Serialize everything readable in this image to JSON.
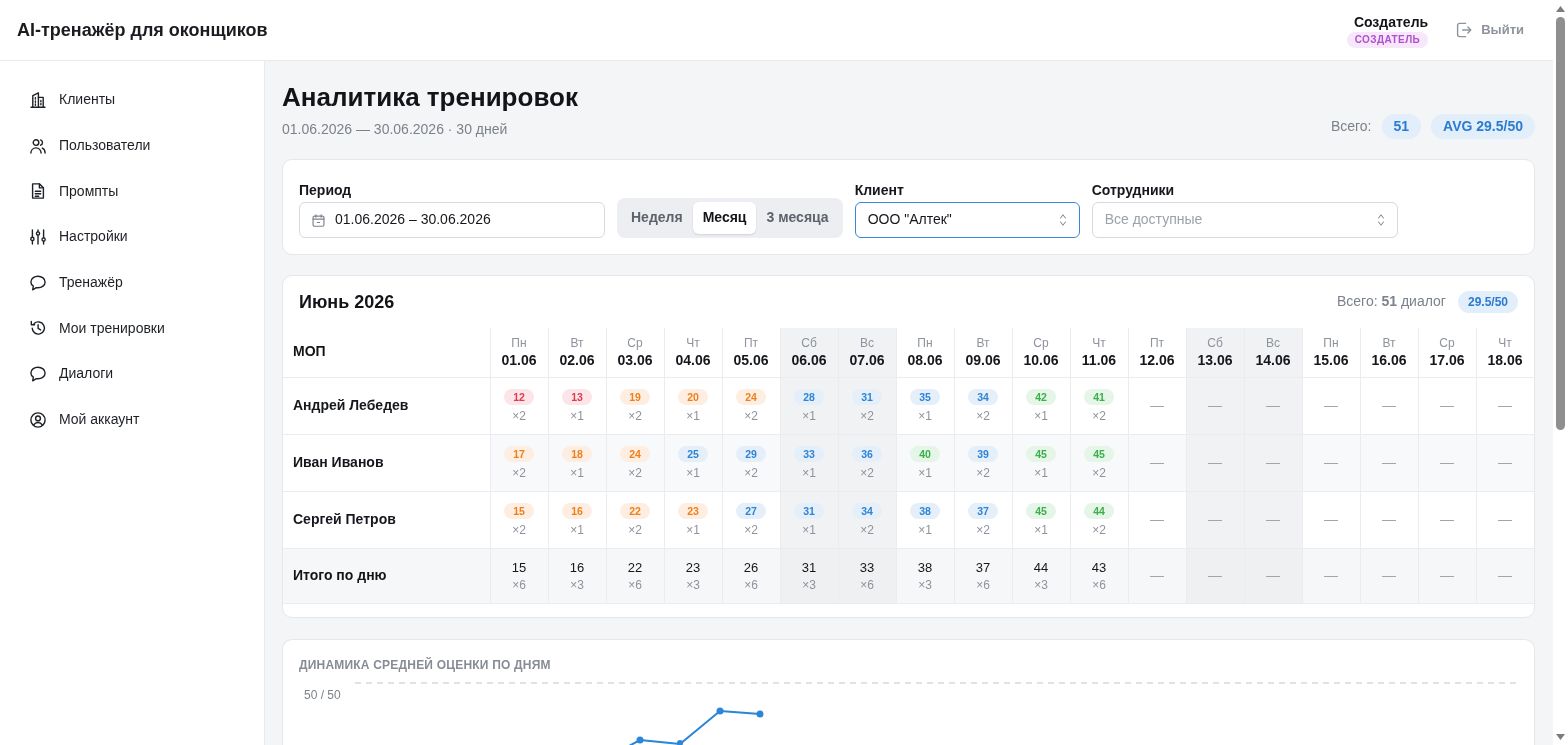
{
  "header": {
    "title": "AI-тренажёр для оконщиков",
    "user_name": "Создатель",
    "role_badge": "СОЗДАТЕЛЬ",
    "logout_button": "Выйти"
  },
  "sidebar": {
    "items": [
      {
        "label": "Клиенты",
        "selected": false
      },
      {
        "label": "Пользователи",
        "selected": false
      },
      {
        "label": "Промпты",
        "selected": false
      },
      {
        "label": "Настройки",
        "selected": false
      },
      {
        "label": "Тренажёр",
        "selected": false
      },
      {
        "label": "Мои тренировки",
        "selected": false
      },
      {
        "label": "Диалоги",
        "selected": false
      },
      {
        "label": "Мой аккаунт",
        "selected": false
      }
    ]
  },
  "page": {
    "title": "Аналитика тренировок",
    "subtitle": "01.06.2026 — 30.06.2026 · 30 дней",
    "total_label": "Всего:",
    "total_count": "51",
    "avg_badge": "AVG 29.5/50"
  },
  "filters": {
    "period": {
      "label": "Период",
      "value": "01.06.2026 – 30.06.2026"
    },
    "range_tabs": [
      {
        "label": "Неделя",
        "selected": false
      },
      {
        "label": "Месяц",
        "selected": true
      },
      {
        "label": "3 месяца",
        "selected": false
      }
    ],
    "client": {
      "label": "Клиент",
      "value": "ООО \"Алтек\"",
      "focused": true
    },
    "staff": {
      "label": "Сотрудники",
      "placeholder": "Все доступные",
      "focused": false
    }
  },
  "calendar_table": {
    "title": "Июнь 2026",
    "summary": "Всего: **51** диалог",
    "avg_badge": "29.5/50",
    "name_header": "МОП",
    "columns": [
      {
        "weekday": "Пн",
        "date": "01.06",
        "weekend": false
      },
      {
        "weekday": "Вт",
        "date": "02.06",
        "weekend": false
      },
      {
        "weekday": "Ср",
        "date": "03.06",
        "weekend": false
      },
      {
        "weekday": "Чт",
        "date": "04.06",
        "weekend": false
      },
      {
        "weekday": "Пт",
        "date": "05.06",
        "weekend": false
      },
      {
        "weekday": "Сб",
        "date": "06.06",
        "weekend": true
      },
      {
        "weekday": "Вс",
        "date": "07.06",
        "weekend": true
      },
      {
        "weekday": "Пн",
        "date": "08.06",
        "weekend": false
      },
      {
        "weekday": "Вт",
        "date": "09.06",
        "weekend": false
      },
      {
        "weekday": "Ср",
        "date": "10.06",
        "weekend": false
      },
      {
        "weekday": "Чт",
        "date": "11.06",
        "weekend": false
      },
      {
        "weekday": "Пт",
        "date": "12.06",
        "weekend": false
      },
      {
        "weekday": "Сб",
        "date": "13.06",
        "weekend": true
      },
      {
        "weekday": "Вс",
        "date": "14.06",
        "weekend": true
      },
      {
        "weekday": "Пн",
        "date": "15.06",
        "weekend": false
      },
      {
        "weekday": "Вт",
        "date": "16.06",
        "weekend": false
      },
      {
        "weekday": "Ср",
        "date": "17.06",
        "weekend": false
      },
      {
        "weekday": "Чт",
        "date": "18.06",
        "weekend": false
      }
    ],
    "rows": [
      {
        "name": "Андрей Лебедев",
        "cells": [
          {
            "kind": "score",
            "score": "12",
            "count": "×2",
            "color": "#e03a4e"
          },
          {
            "kind": "score",
            "score": "13",
            "count": "×1",
            "color": "#e03a4e"
          },
          {
            "kind": "score",
            "score": "19",
            "count": "×2",
            "color": "#ef7f1a"
          },
          {
            "kind": "score",
            "score": "20",
            "count": "×1",
            "color": "#ef7f1a"
          },
          {
            "kind": "score",
            "score": "24",
            "count": "×2",
            "color": "#ef7f1a"
          },
          {
            "kind": "score",
            "score": "28",
            "count": "×1",
            "color": "#2f84d4"
          },
          {
            "kind": "score",
            "score": "31",
            "count": "×2",
            "color": "#2f84d4"
          },
          {
            "kind": "score",
            "score": "35",
            "count": "×1",
            "color": "#2f84d4"
          },
          {
            "kind": "score",
            "score": "34",
            "count": "×2",
            "color": "#2f84d4"
          },
          {
            "kind": "score",
            "score": "42",
            "count": "×1",
            "color": "#3aaf4a"
          },
          {
            "kind": "score",
            "score": "41",
            "count": "×2",
            "color": "#3aaf4a"
          },
          {
            "kind": "empty",
            "text": "—"
          },
          {
            "kind": "empty",
            "text": "—"
          },
          {
            "kind": "empty",
            "text": "—"
          },
          {
            "kind": "empty",
            "text": "—"
          },
          {
            "kind": "empty",
            "text": "—"
          },
          {
            "kind": "empty",
            "text": "—"
          },
          {
            "kind": "empty",
            "text": "—"
          }
        ]
      },
      {
        "name": "Иван Иванов",
        "cells": [
          {
            "kind": "score",
            "score": "17",
            "count": "×2",
            "color": "#ef7f1a"
          },
          {
            "kind": "score",
            "score": "18",
            "count": "×1",
            "color": "#ef7f1a"
          },
          {
            "kind": "score",
            "score": "24",
            "count": "×2",
            "color": "#ef7f1a"
          },
          {
            "kind": "score",
            "score": "25",
            "count": "×1",
            "color": "#2f84d4"
          },
          {
            "kind": "score",
            "score": "29",
            "count": "×2",
            "color": "#2f84d4"
          },
          {
            "kind": "score",
            "score": "33",
            "count": "×1",
            "color": "#2f84d4"
          },
          {
            "kind": "score",
            "score": "36",
            "count": "×2",
            "color": "#2f84d4"
          },
          {
            "kind": "score",
            "score": "40",
            "count": "×1",
            "color": "#3aaf4a"
          },
          {
            "kind": "score",
            "score": "39",
            "count": "×2",
            "color": "#2f84d4"
          },
          {
            "kind": "score",
            "score": "45",
            "count": "×1",
            "color": "#3aaf4a"
          },
          {
            "kind": "score",
            "score": "45",
            "count": "×2",
            "color": "#3aaf4a"
          },
          {
            "kind": "empty",
            "text": "—"
          },
          {
            "kind": "empty",
            "text": "—"
          },
          {
            "kind": "empty",
            "text": "—"
          },
          {
            "kind": "empty",
            "text": "—"
          },
          {
            "kind": "empty",
            "text": "—"
          },
          {
            "kind": "empty",
            "text": "—"
          },
          {
            "kind": "empty",
            "text": "—"
          }
        ]
      },
      {
        "name": "Сергей Петров",
        "cells": [
          {
            "kind": "score",
            "score": "15",
            "count": "×2",
            "color": "#ef7f1a"
          },
          {
            "kind": "score",
            "score": "16",
            "count": "×1",
            "color": "#ef7f1a"
          },
          {
            "kind": "score",
            "score": "22",
            "count": "×2",
            "color": "#ef7f1a"
          },
          {
            "kind": "score",
            "score": "23",
            "count": "×1",
            "color": "#ef7f1a"
          },
          {
            "kind": "score",
            "score": "27",
            "count": "×2",
            "color": "#2f84d4"
          },
          {
            "kind": "score",
            "score": "31",
            "count": "×1",
            "color": "#2f84d4"
          },
          {
            "kind": "score",
            "score": "34",
            "count": "×2",
            "color": "#2f84d4"
          },
          {
            "kind": "score",
            "score": "38",
            "count": "×1",
            "color": "#2f84d4"
          },
          {
            "kind": "score",
            "score": "37",
            "count": "×2",
            "color": "#2f84d4"
          },
          {
            "kind": "score",
            "score": "45",
            "count": "×1",
            "color": "#3aaf4a"
          },
          {
            "kind": "score",
            "score": "44",
            "count": "×2",
            "color": "#3aaf4a"
          },
          {
            "kind": "empty",
            "text": "—"
          },
          {
            "kind": "empty",
            "text": "—"
          },
          {
            "kind": "empty",
            "text": "—"
          },
          {
            "kind": "empty",
            "text": "—"
          },
          {
            "kind": "empty",
            "text": "—"
          },
          {
            "kind": "empty",
            "text": "—"
          },
          {
            "kind": "empty",
            "text": "—"
          }
        ]
      }
    ],
    "total_row": {
      "label": "Итого по дню",
      "cells": [
        {
          "kind": "total",
          "score": "15",
          "count": "×6"
        },
        {
          "kind": "total",
          "score": "16",
          "count": "×3"
        },
        {
          "kind": "total",
          "score": "22",
          "count": "×6"
        },
        {
          "kind": "total",
          "score": "23",
          "count": "×3"
        },
        {
          "kind": "total",
          "score": "26",
          "count": "×6"
        },
        {
          "kind": "total",
          "score": "31",
          "count": "×3"
        },
        {
          "kind": "total",
          "score": "33",
          "count": "×6"
        },
        {
          "kind": "total",
          "score": "38",
          "count": "×3"
        },
        {
          "kind": "total",
          "score": "37",
          "count": "×6"
        },
        {
          "kind": "total",
          "score": "44",
          "count": "×3"
        },
        {
          "kind": "total",
          "score": "43",
          "count": "×6"
        },
        {
          "kind": "empty",
          "text": "—"
        },
        {
          "kind": "empty",
          "text": "—"
        },
        {
          "kind": "empty",
          "text": "—"
        },
        {
          "kind": "empty",
          "text": "—"
        },
        {
          "kind": "empty",
          "text": "—"
        },
        {
          "kind": "empty",
          "text": "—"
        },
        {
          "kind": "empty",
          "text": "—"
        }
      ]
    }
  },
  "chart": {
    "title": "ДИНАМИКА СРЕДНЕЙ ОЦЕНКИ ПО ДНЯМ",
    "y_tick_label": "50 / 50"
  }
}
